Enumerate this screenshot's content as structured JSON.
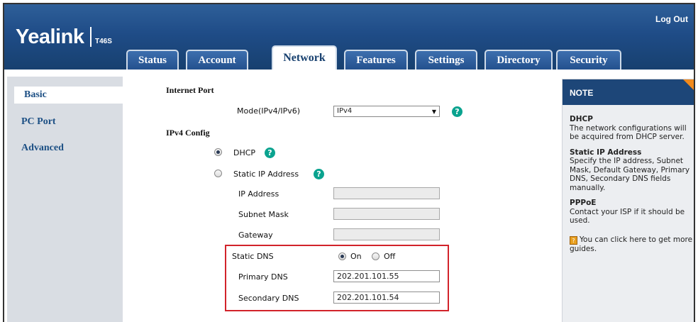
{
  "header": {
    "logo": "Yealink",
    "model": "T46S",
    "logout": "Log Out"
  },
  "tabs": [
    {
      "label": "Status",
      "active": false
    },
    {
      "label": "Account",
      "active": false
    },
    {
      "label": "Network",
      "active": true
    },
    {
      "label": "Features",
      "active": false
    },
    {
      "label": "Settings",
      "active": false
    },
    {
      "label": "Directory",
      "active": false
    },
    {
      "label": "Security",
      "active": false
    }
  ],
  "sidebar": {
    "items": [
      {
        "label": "Basic",
        "active": true
      },
      {
        "label": "PC Port",
        "active": false
      },
      {
        "label": "Advanced",
        "active": false
      }
    ]
  },
  "form": {
    "internet_port": "Internet Port",
    "mode_label": "Mode(IPv4/IPv6)",
    "mode_value": "IPv4",
    "ipv4_config": "IPv4 Config",
    "dhcp_label": "DHCP",
    "static_ip_label": "Static IP Address",
    "ip_address_label": "IP Address",
    "subnet_mask_label": "Subnet Mask",
    "gateway_label": "Gateway",
    "static_dns_label": "Static DNS",
    "on_label": "On",
    "off_label": "Off",
    "primary_dns_label": "Primary DNS",
    "primary_dns_value": "202.201.101.55",
    "secondary_dns_label": "Secondary DNS",
    "secondary_dns_value": "202.201.101.54",
    "help_symbol": "?"
  },
  "note": {
    "title": "NOTE",
    "dhcp_title": "DHCP",
    "dhcp_text": "The network configurations will be acquired from DHCP server.",
    "static_title": "Static IP Address",
    "static_text": "Specify the IP address, Subnet Mask, Default Gateway, Primary DNS, Secondary DNS fields manually.",
    "pppoe_title": "PPPoE",
    "pppoe_text": "Contact your ISP if it should be used.",
    "guide_text": "You can click here to get more guides."
  },
  "colors": {
    "header_blue": "#1f4c87",
    "highlight_red": "#d2232a",
    "help_teal": "#0aa38f",
    "note_orange": "#f28a1c"
  }
}
